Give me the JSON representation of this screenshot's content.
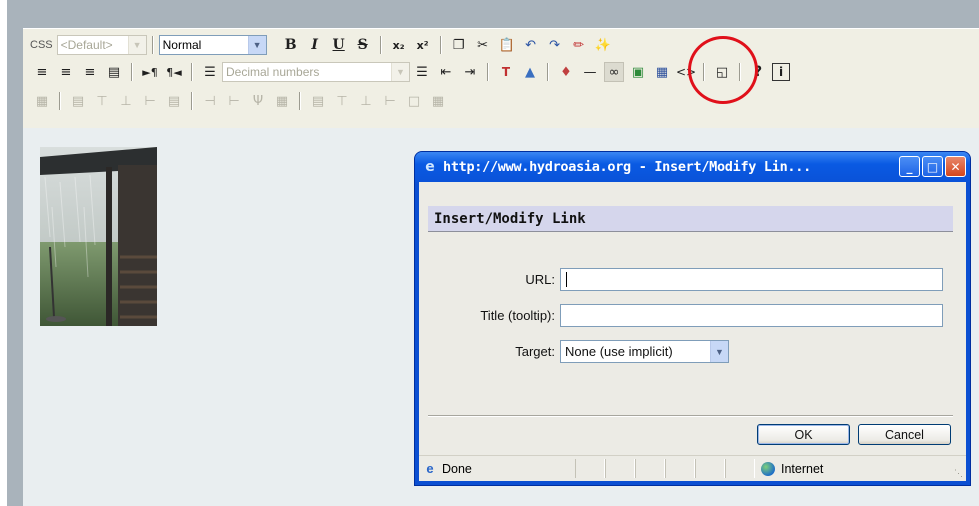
{
  "toolbar": {
    "css_label": "CSS",
    "css_select": "<Default>",
    "format_select": "Normal",
    "bold": "B",
    "italic": "I",
    "underline": "U",
    "strike": "S",
    "subscript": "x₂",
    "superscript": "x²",
    "list_style_select": "Decimal numbers",
    "help": "?",
    "info": "i"
  },
  "dialog": {
    "window_title": "http://www.hydroasia.org - Insert/Modify Lin...",
    "heading": "Insert/Modify Link",
    "url_label": "URL:",
    "url_value": "",
    "title_label": "Title (tooltip):",
    "title_value": "",
    "target_label": "Target:",
    "target_value": "None (use implicit)",
    "ok_label": "OK",
    "cancel_label": "Cancel",
    "status_text": "Done",
    "zone_text": "Internet"
  },
  "colors": {
    "highlight_circle": "#e0101a",
    "titlebar": "#0a5ae3",
    "dialog_header": "#d5d6ec"
  }
}
